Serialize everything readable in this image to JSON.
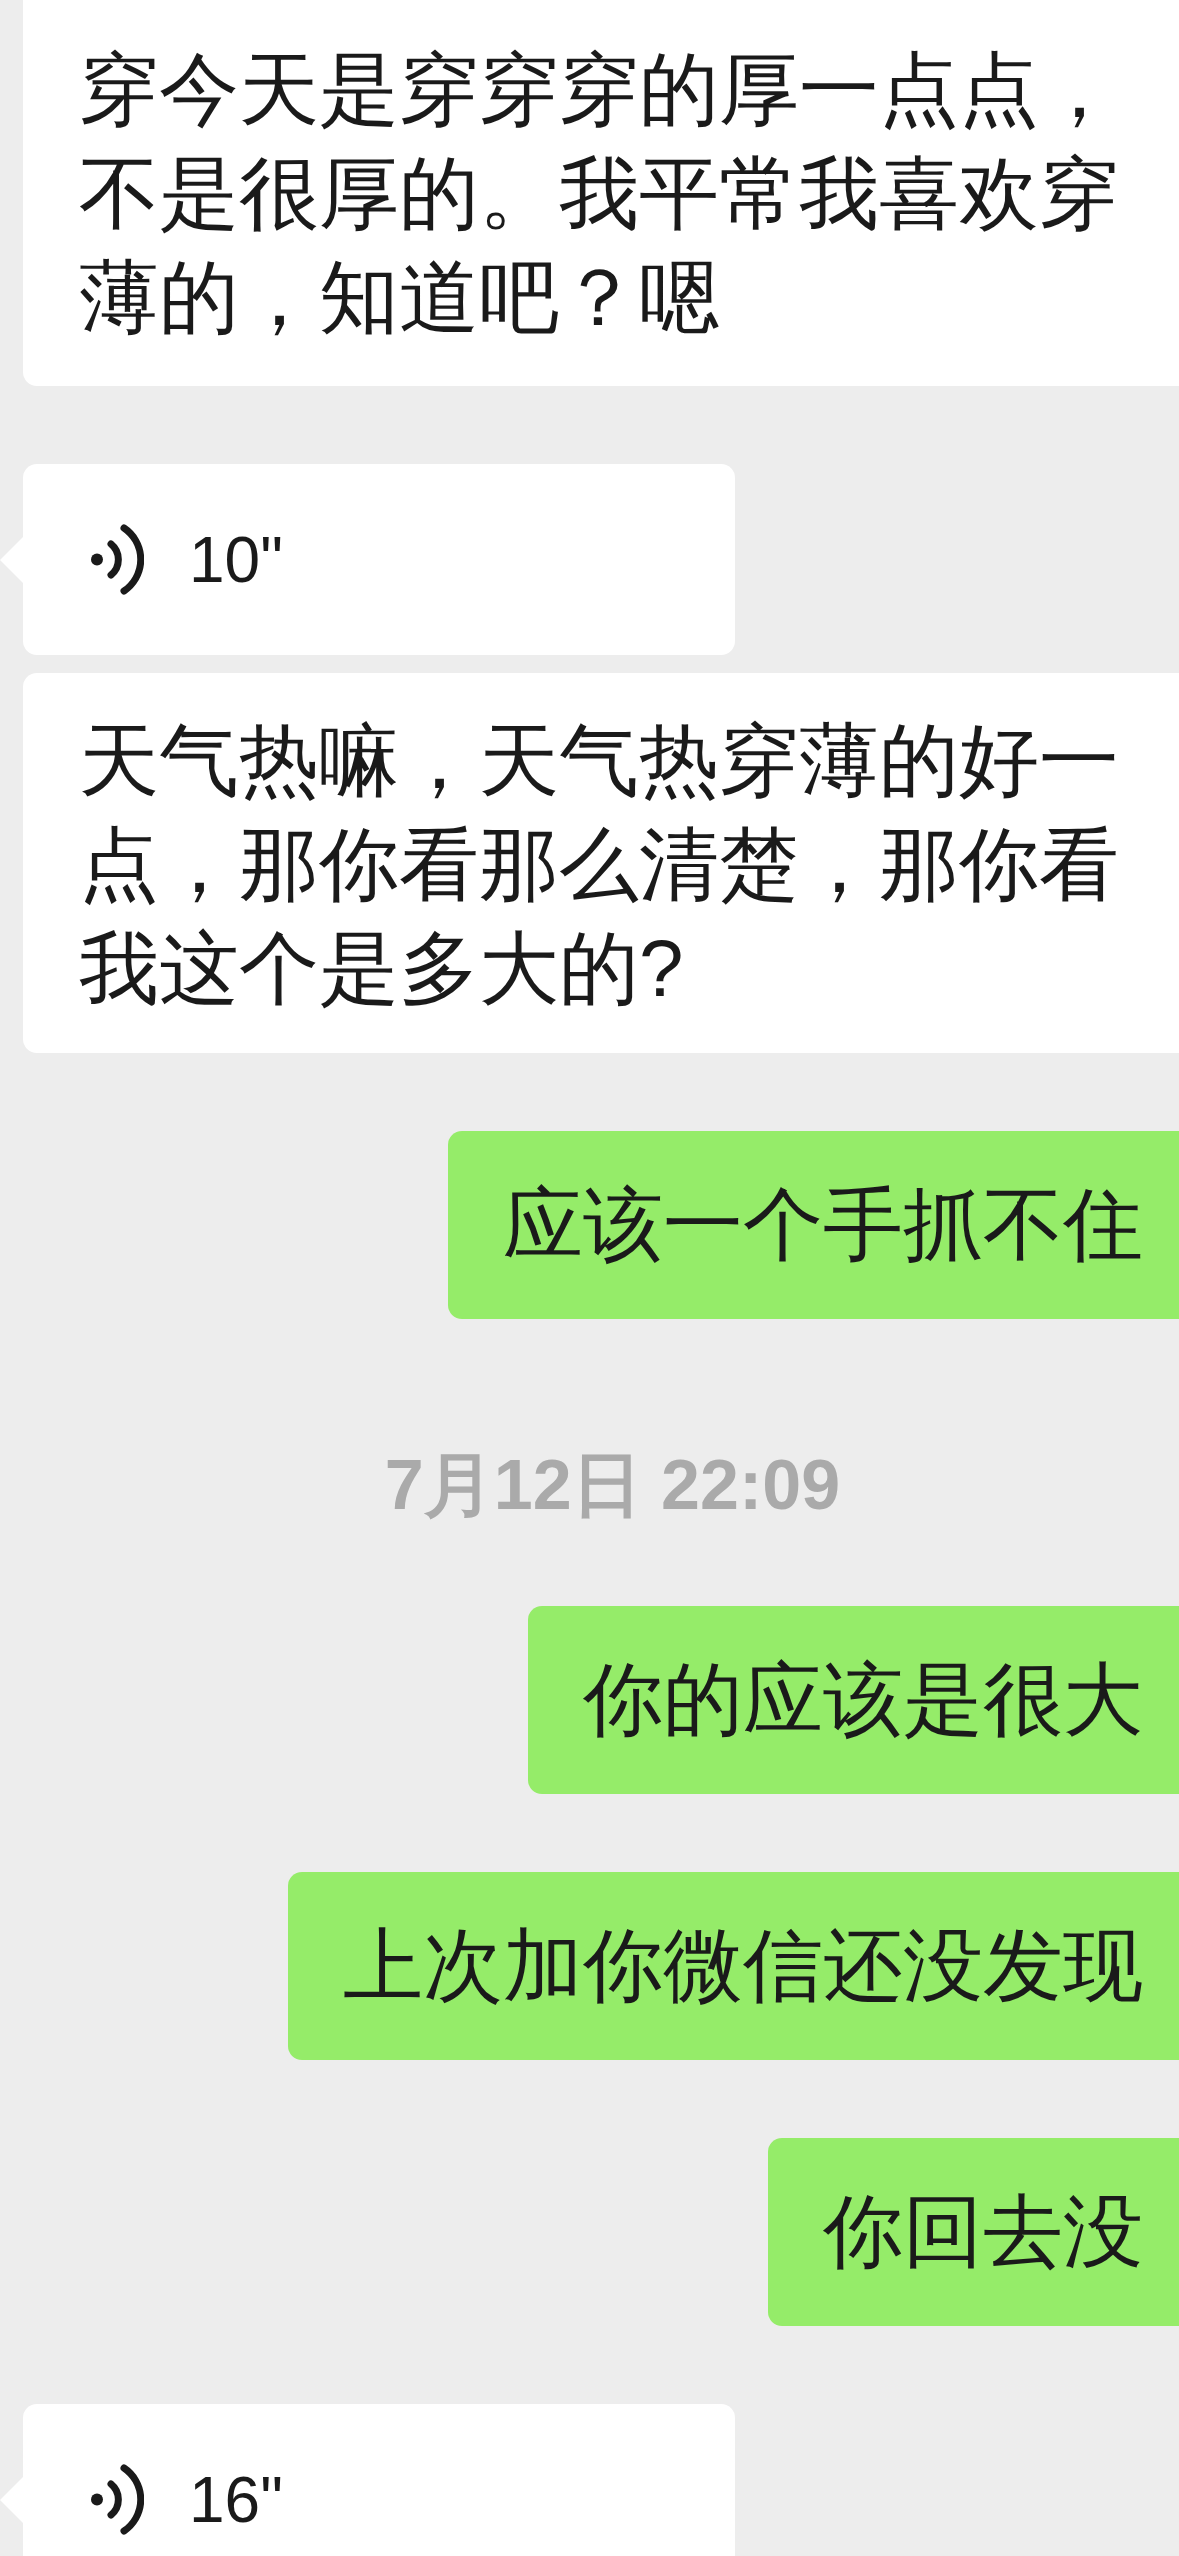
{
  "messages": [
    {
      "kind": "transcript",
      "outgoing": false,
      "text": "穿今天是穿穿穿的厚一点点，不是很厚的。我平常我喜欢穿薄的，知道吧？嗯"
    },
    {
      "kind": "voice",
      "outgoing": false,
      "duration": "10\"",
      "transcript": "天气热嘛，天气热穿薄的好一点，那你看那么清楚，那你看我这个是多大的?"
    },
    {
      "kind": "text",
      "outgoing": true,
      "text": "应该一个手抓不住"
    },
    {
      "kind": "time",
      "text": "7月12日 22:09"
    },
    {
      "kind": "text",
      "outgoing": true,
      "text": "你的应该是很大"
    },
    {
      "kind": "text",
      "outgoing": true,
      "text": "上次加你微信还没发现"
    },
    {
      "kind": "text",
      "outgoing": true,
      "text": "你回去没"
    },
    {
      "kind": "voice",
      "outgoing": false,
      "duration": "16\""
    }
  ]
}
